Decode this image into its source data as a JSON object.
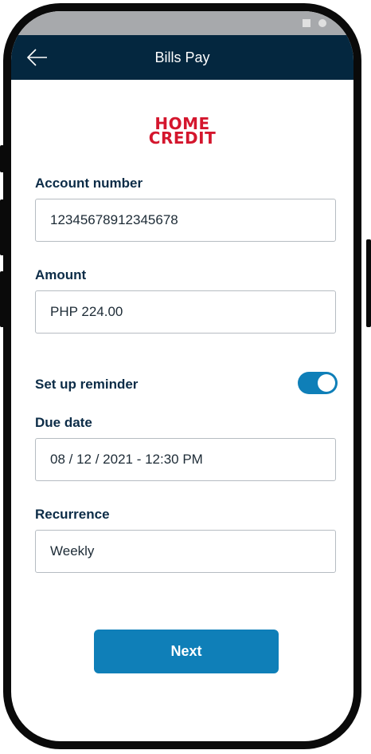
{
  "header": {
    "title": "Bills Pay",
    "back_icon": "arrow-left-icon"
  },
  "brand": {
    "logo_line1": "HOME",
    "logo_line2": "CREDIT",
    "logo_color": "#d4162d"
  },
  "form": {
    "account_number": {
      "label": "Account number",
      "value": "12345678912345678"
    },
    "amount": {
      "label": "Amount",
      "value": "PHP 224.00"
    },
    "reminder": {
      "label": "Set up reminder",
      "enabled": true
    },
    "due_date": {
      "label": "Due date",
      "value": "08 / 12 / 2021 - 12:30 PM"
    },
    "recurrence": {
      "label": "Recurrence",
      "value": "Weekly"
    }
  },
  "actions": {
    "next_label": "Next"
  },
  "colors": {
    "header_bg": "#04273f",
    "accent": "#0f7fb8",
    "label_text": "#0c2c47"
  }
}
